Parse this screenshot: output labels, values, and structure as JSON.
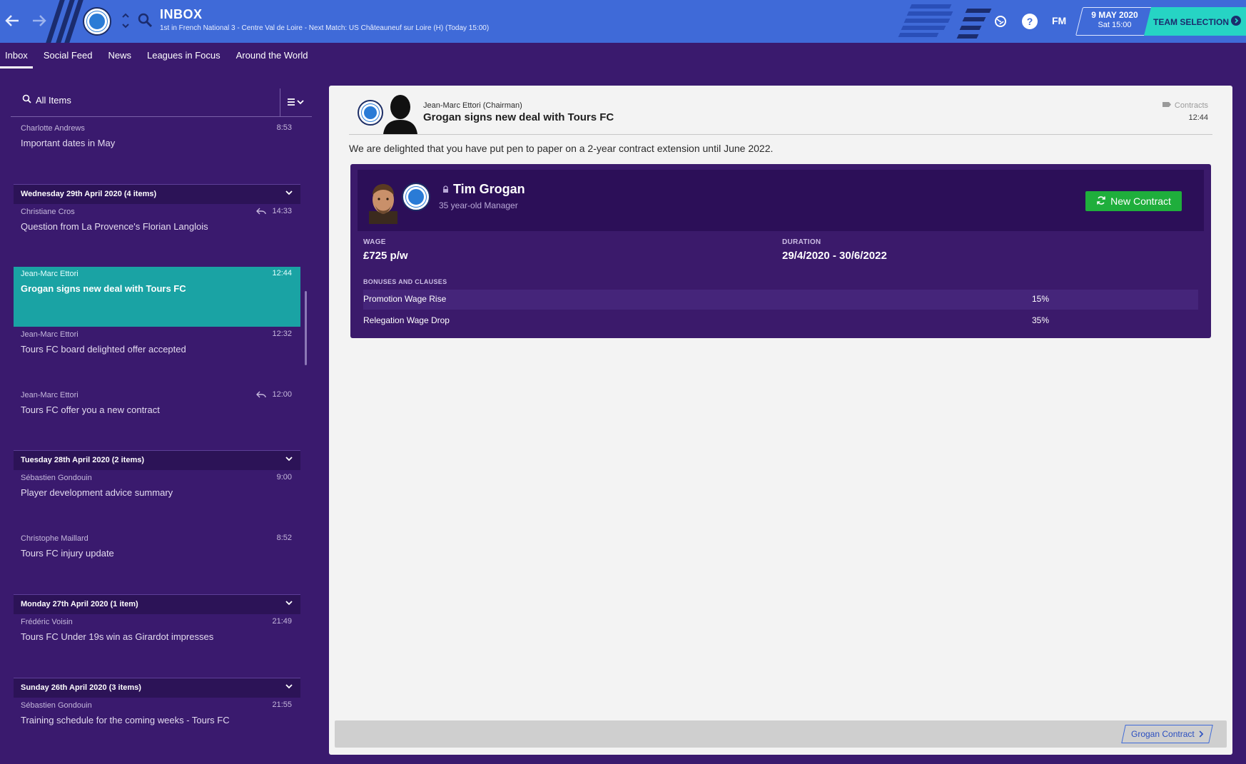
{
  "topbar": {
    "title": "INBOX",
    "subtitle": "1st in French National 3 - Centre Val de Loire - Next Match: US Châteauneuf sur Loire (H) (Today 15:00)",
    "fm_label": "FM",
    "date": "9 MAY 2020",
    "time": "Sat 15:00",
    "team_selection": "TEAM SELECTION"
  },
  "tabs": [
    {
      "label": "Inbox",
      "active": true
    },
    {
      "label": "Social Feed",
      "active": false
    },
    {
      "label": "News",
      "active": false
    },
    {
      "label": "Leagues in Focus",
      "active": false
    },
    {
      "label": "Around the World",
      "active": false
    }
  ],
  "filter": {
    "label": "All Items"
  },
  "inbox": {
    "items": [
      {
        "from": "Charlotte Andrews",
        "time": "8:53",
        "subject": "Important dates in May",
        "replied": false
      },
      {
        "from": "Christiane Cros",
        "time": "14:33",
        "subject": "Question from La Provence's Florian Langlois",
        "replied": true
      },
      {
        "from": "Jean-Marc Ettori",
        "time": "12:44",
        "subject": "Grogan signs new deal with Tours FC",
        "replied": false,
        "selected": true
      },
      {
        "from": "Jean-Marc Ettori",
        "time": "12:32",
        "subject": "Tours FC board delighted offer accepted",
        "replied": false
      },
      {
        "from": "Jean-Marc Ettori",
        "time": "12:00",
        "subject": "Tours FC offer you a new contract",
        "replied": true
      },
      {
        "from": "Sébastien Gondouin",
        "time": "9:00",
        "subject": "Player development advice summary",
        "replied": false
      },
      {
        "from": "Christophe Maillard",
        "time": "8:52",
        "subject": "Tours FC injury update",
        "replied": false
      },
      {
        "from": "Frédéric Voisin",
        "time": "21:49",
        "subject": "Tours FC Under 19s win as Girardot impresses",
        "replied": false
      },
      {
        "from": "Sébastien Gondouin",
        "time": "21:55",
        "subject": "Training schedule for the coming weeks - Tours FC",
        "replied": false
      }
    ],
    "groups": [
      {
        "label": "Wednesday 29th April 2020 (4 items)"
      },
      {
        "label": "Tuesday 28th April 2020 (2 items)"
      },
      {
        "label": "Monday 27th April 2020 (1 item)"
      },
      {
        "label": "Sunday 26th April 2020 (3 items)"
      }
    ]
  },
  "message": {
    "from": "Jean-Marc Ettori  (Chairman)",
    "subject": "Grogan signs new deal with Tours FC",
    "category": "Contracts",
    "time": "12:44",
    "body": "We are delighted that you have put pen to paper on a 2-year contract extension until June 2022.",
    "contract": {
      "player_name": "Tim Grogan",
      "player_desc": "35 year-old Manager",
      "new_contract_label": "New Contract",
      "wage_label": "WAGE",
      "wage_value": "£725 p/w",
      "duration_label": "DURATION",
      "duration_value": "29/4/2020 - 30/6/2022",
      "bonuses_label": "BONUSES AND CLAUSES",
      "clauses": [
        {
          "label": "Promotion Wage Rise",
          "value": "15%"
        },
        {
          "label": "Relegation Wage Drop",
          "value": "35%"
        }
      ]
    },
    "footer_link": "Grogan Contract"
  },
  "colors": {
    "topbar": "#3f6ad8",
    "background": "#3a1a6e",
    "selected_item": "#1aa3a4",
    "team_selection": "#26d4c4",
    "new_contract": "#1fae3c"
  },
  "icons": [
    "back-arrow-icon",
    "forward-arrow-icon",
    "club-crest-icon",
    "search-icon",
    "globe-icon",
    "help-icon",
    "menu-icon",
    "reply-icon",
    "refresh-icon",
    "tag-icon",
    "chevron-right-icon"
  ]
}
